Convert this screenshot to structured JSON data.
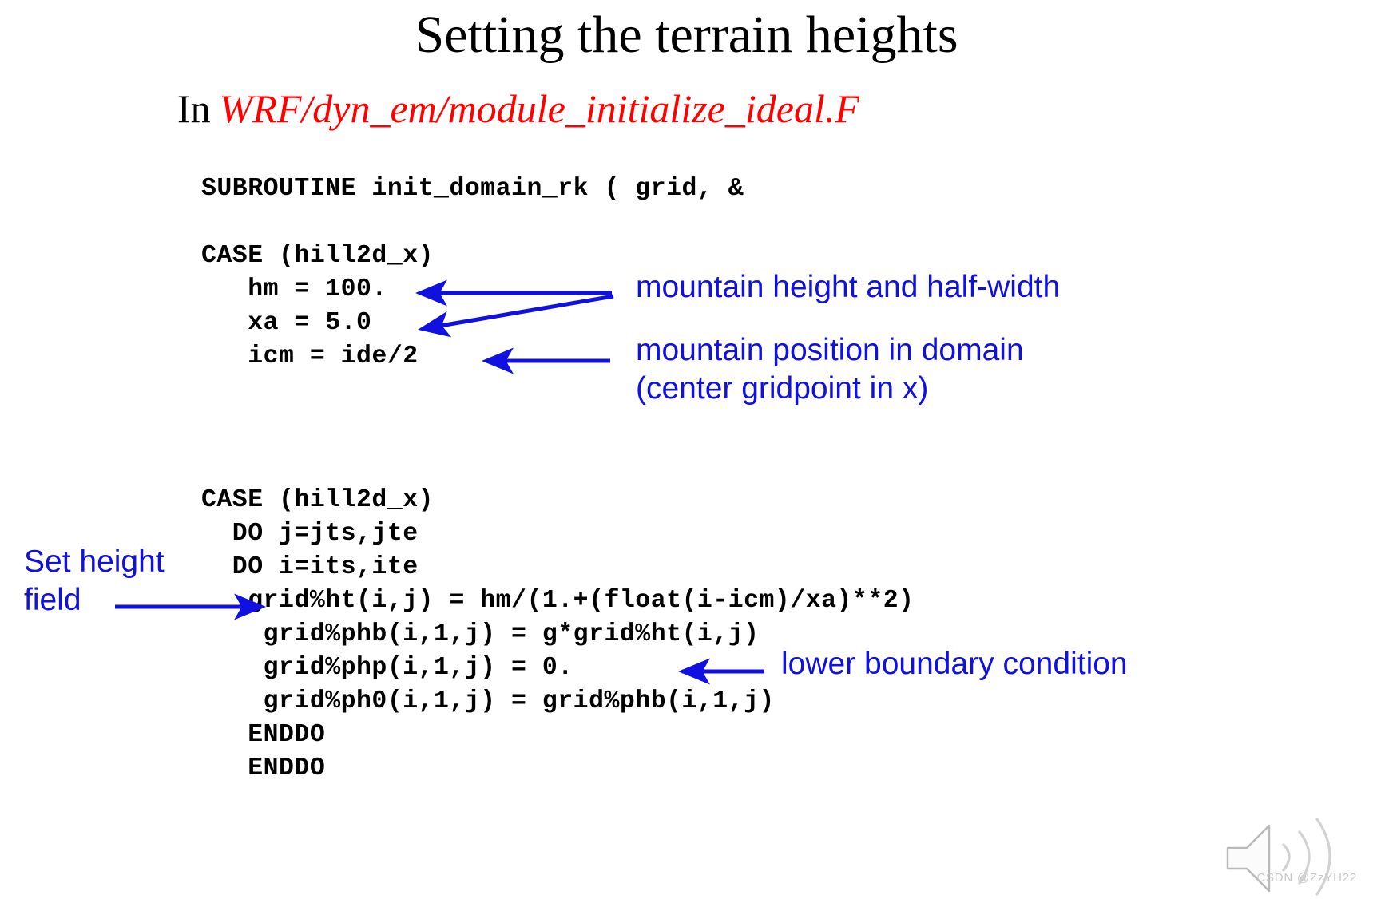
{
  "slide": {
    "title": "Setting the terrain heights",
    "subtitle_prefix": "In",
    "subtitle_path": "WRF/dyn_em/module_initialize_ideal.F",
    "background_color": "#ffffff",
    "title_color": "#000000",
    "path_color": "#ff0000",
    "annotation_color": "#1010e0",
    "code_color": "#000000"
  },
  "code_top": "SUBROUTINE init_domain_rk ( grid, &\n\nCASE (hill2d_x)\n   hm = 100.\n   xa = 5.0\n   icm = ide/2",
  "code_bottom": "CASE (hill2d_x)\n  DO j=jts,jte\n  DO i=its,ite\n   grid%ht(i,j) = hm/(1.+(float(i-icm)/xa)**2)\n    grid%phb(i,1,j) = g*grid%ht(i,j)\n    grid%php(i,1,j) = 0.\n    grid%ph0(i,1,j) = grid%phb(i,1,j)\n   ENDDO\n   ENDDO",
  "code_top_lines": [
    "SUBROUTINE init_domain_rk ( grid, &",
    "",
    "CASE (hill2d_x)",
    "   hm = 100.",
    "   xa = 5.0",
    "   icm = ide/2"
  ],
  "code_bottom_lines": [
    "CASE (hill2d_x)",
    "  DO j=jts,jte",
    "  DO i=its,ite",
    "   grid%ht(i,j) = hm/(1.+(float(i-icm)/xa)**2)",
    "    grid%phb(i,1,j) = g*grid%ht(i,j)",
    "    grid%php(i,1,j) = 0.",
    "    grid%ph0(i,1,j) = grid%phb(i,1,j)",
    "   ENDDO",
    "   ENDDO"
  ],
  "annotations": {
    "mountain_height": "mountain height and half-width",
    "mountain_position": "mountain position in domain\n(center gridpoint in x)",
    "set_height_field": "Set height\nfield",
    "lower_boundary": "lower boundary condition"
  },
  "watermark": {
    "text": "CSDN @ZzYH22",
    "icon": "speaker-icon",
    "color": "#c8c8c8"
  }
}
